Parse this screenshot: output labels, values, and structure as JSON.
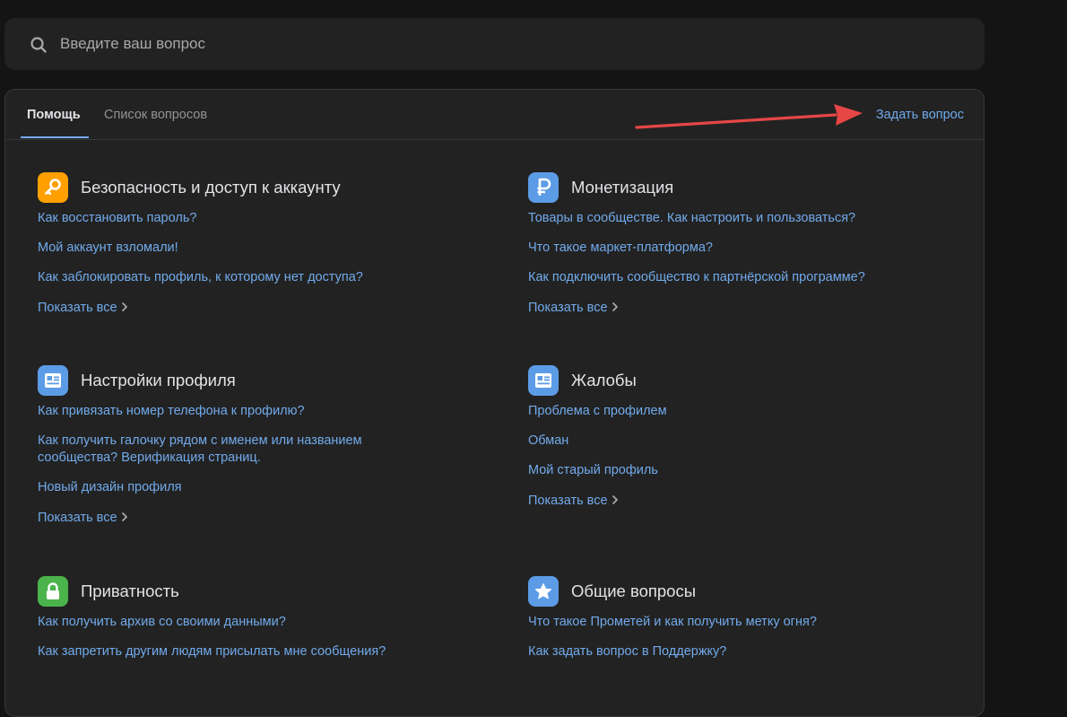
{
  "search": {
    "placeholder": "Введите ваш вопрос",
    "value": ""
  },
  "tabs": [
    {
      "label": "Помощь",
      "active": true
    },
    {
      "label": "Список вопросов",
      "active": false
    }
  ],
  "ask_question": "Задать вопрос",
  "show_all_label": "Показать все",
  "colors": {
    "accent": "#71aaeb",
    "arrow": "#e64646",
    "security_badge": "#ffa000",
    "monetization_badge": "#5c9ce6",
    "privacy_badge": "#4bb34b"
  },
  "sections": [
    {
      "title": "Безопасность и доступ к аккаунту",
      "icon": "key-icon",
      "links": [
        "Как восстановить пароль?",
        "Мой аккаунт взломали!",
        "Как заблокировать профиль, к которому нет доступа?"
      ]
    },
    {
      "title": "Монетизация",
      "icon": "ruble-icon",
      "links": [
        "Товары в сообществе. Как настроить и пользоваться?",
        "Что такое маркет-платформа?",
        "Как подключить сообщество к партнёрской программе?"
      ]
    },
    {
      "title": "Настройки профиля",
      "icon": "profile-card-icon",
      "links": [
        "Как привязать номер телефона к профилю?",
        "Как получить галочку рядом с именем или названием сообщества? Верификация страниц.",
        "Новый дизайн профиля"
      ]
    },
    {
      "title": "Жалобы",
      "icon": "profile-card-icon",
      "links": [
        "Проблема с профилем",
        "Обман",
        "Мой старый профиль"
      ]
    },
    {
      "title": "Приватность",
      "icon": "lock-icon",
      "links": [
        "Как получить архив со своими данными?",
        "Как запретить другим людям присылать мне сообщения?"
      ]
    },
    {
      "title": "Общие вопросы",
      "icon": "star-icon",
      "links": [
        "Что такое Прометей и как получить метку огня?",
        "Как задать вопрос в Поддержку?"
      ]
    }
  ]
}
